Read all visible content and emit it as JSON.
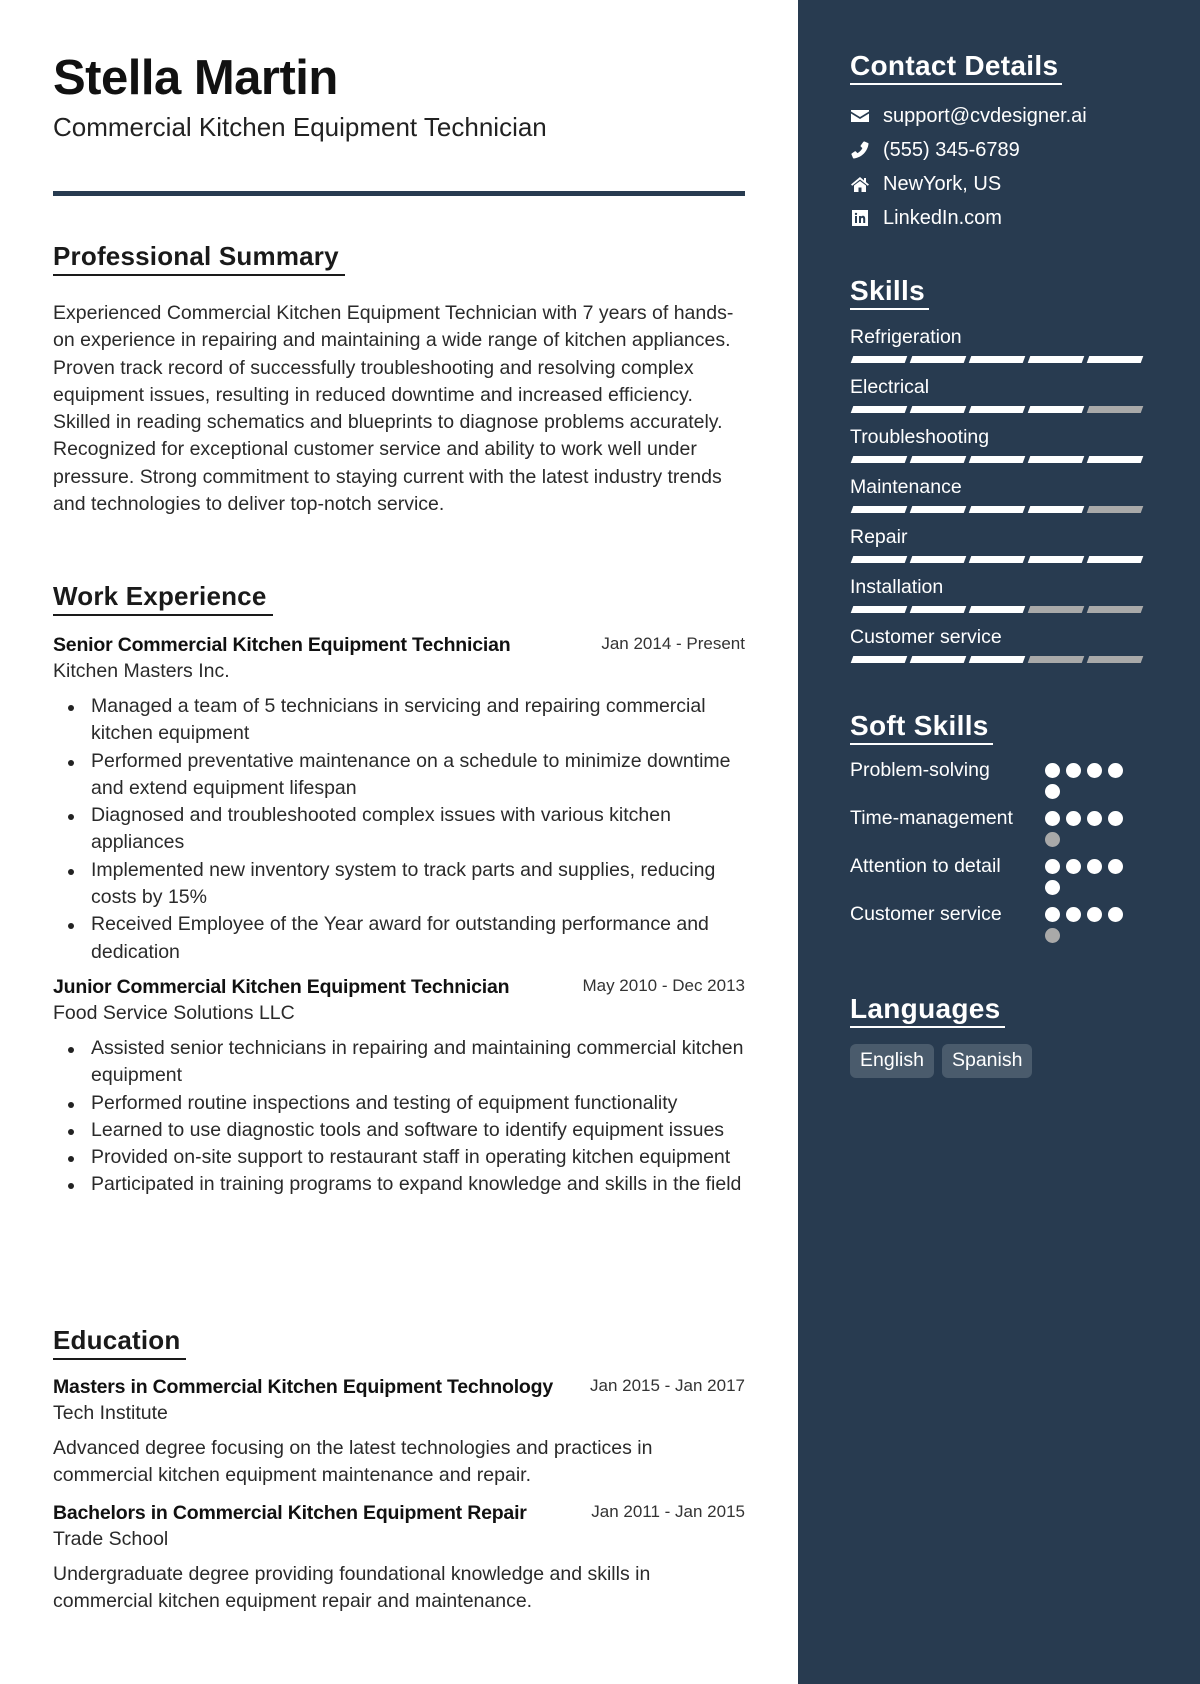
{
  "header": {
    "name": "Stella Martin",
    "title": "Commercial Kitchen Equipment Technician"
  },
  "summary": {
    "heading": "Professional Summary",
    "text": "Experienced Commercial Kitchen Equipment Technician with 7 years of hands-on experience in repairing and maintaining a wide range of kitchen appliances. Proven track record of successfully troubleshooting and resolving complex equipment issues, resulting in reduced downtime and increased efficiency. Skilled in reading schematics and blueprints to diagnose problems accurately. Recognized for exceptional customer service and ability to work well under pressure. Strong commitment to staying current with the latest industry trends and technologies to deliver top-notch service."
  },
  "work": {
    "heading": "Work Experience",
    "jobs": [
      {
        "title": "Senior Commercial Kitchen Equipment Technician",
        "date": "Jan 2014 - Present",
        "company": "Kitchen Masters Inc.",
        "bullets": [
          "Managed a team of 5 technicians in servicing and repairing commercial kitchen equipment",
          "Performed preventative maintenance on a schedule to minimize downtime and extend equipment lifespan",
          "Diagnosed and troubleshooted complex issues with various kitchen appliances",
          "Implemented new inventory system to track parts and supplies, reducing costs by 15%",
          "Received Employee of the Year award for outstanding performance and dedication"
        ]
      },
      {
        "title": "Junior Commercial Kitchen Equipment Technician",
        "date": "May 2010 - Dec 2013",
        "company": "Food Service Solutions LLC",
        "bullets": [
          "Assisted senior technicians in repairing and maintaining commercial kitchen equipment",
          "Performed routine inspections and testing of equipment functionality",
          "Learned to use diagnostic tools and software to identify equipment issues",
          "Provided on-site support to restaurant staff in operating kitchen equipment",
          "Participated in training programs to expand knowledge and skills in the field"
        ]
      }
    ]
  },
  "education": {
    "heading": "Education",
    "items": [
      {
        "degree": "Masters in Commercial Kitchen Equipment Technology",
        "date": "Jan 2015 - Jan 2017",
        "school": "Tech Institute",
        "description": "Advanced degree focusing on the latest technologies and practices in commercial kitchen equipment maintenance and repair."
      },
      {
        "degree": "Bachelors in Commercial Kitchen Equipment Repair",
        "date": "Jan 2011 - Jan 2015",
        "school": "Trade School",
        "description": "Undergraduate degree providing foundational knowledge and skills in commercial kitchen equipment repair and maintenance."
      }
    ]
  },
  "contact": {
    "heading": "Contact Details",
    "items": [
      {
        "icon": "envelope-icon",
        "text": "support@cvdesigner.ai"
      },
      {
        "icon": "phone-icon",
        "text": "(555) 345-6789"
      },
      {
        "icon": "home-icon",
        "text": "NewYork, US"
      },
      {
        "icon": "linkedin-icon",
        "text": "LinkedIn.com"
      }
    ]
  },
  "skills": {
    "heading": "Skills",
    "max": 5,
    "items": [
      {
        "name": "Refrigeration",
        "level": 5
      },
      {
        "name": "Electrical",
        "level": 4
      },
      {
        "name": "Troubleshooting",
        "level": 5
      },
      {
        "name": "Maintenance",
        "level": 4
      },
      {
        "name": "Repair",
        "level": 5
      },
      {
        "name": "Installation",
        "level": 3
      },
      {
        "name": "Customer service",
        "level": 3
      }
    ]
  },
  "soft_skills": {
    "heading": "Soft Skills",
    "max": 5,
    "items": [
      {
        "name": "Problem-solving",
        "level": 5
      },
      {
        "name": "Time-management",
        "level": 4
      },
      {
        "name": "Attention to detail",
        "level": 5
      },
      {
        "name": "Customer service",
        "level": 4
      }
    ]
  },
  "languages": {
    "heading": "Languages",
    "items": [
      "English",
      "Spanish"
    ]
  },
  "colors": {
    "sidebar": "#283b50",
    "rating_on": "#ffffff",
    "rating_off": "#a9a9a9",
    "chip": "#4a5b6c"
  }
}
